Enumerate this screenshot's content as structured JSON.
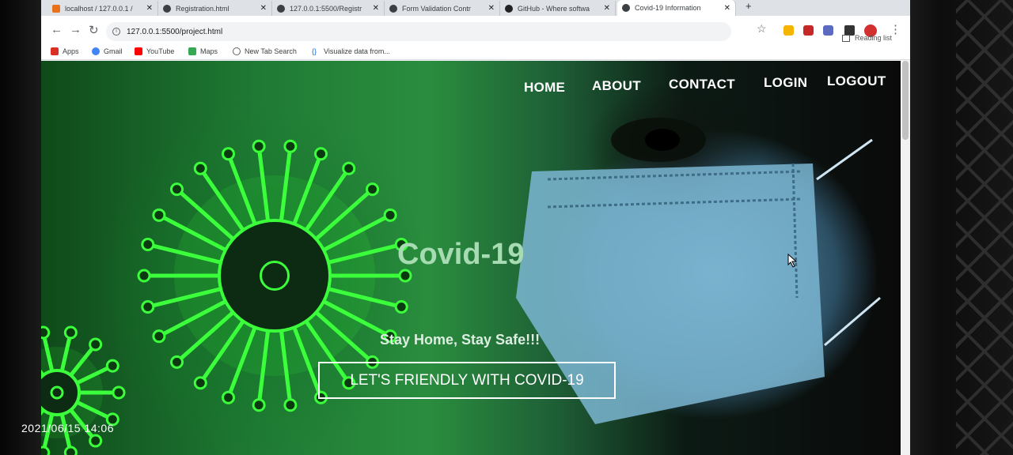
{
  "browser": {
    "tabs": [
      {
        "title": "localhost / 127.0.0.1 /",
        "icon": "phpmyadmin-icon"
      },
      {
        "title": "Registration.html",
        "icon": "globe-icon"
      },
      {
        "title": "127.0.0.1:5500/Registr",
        "icon": "globe-icon"
      },
      {
        "title": "Form Validation Contr",
        "icon": "globe-icon"
      },
      {
        "title": "GitHub - Where softwa",
        "icon": "github-icon"
      },
      {
        "title": "Covid-19 Information",
        "icon": "globe-icon",
        "active": true
      }
    ],
    "new_tab_label": "+",
    "close_glyph": "✕",
    "url": "127.0.0.1:5500/project.html",
    "reading_list": "Reading list",
    "bookmarks": [
      {
        "label": "Apps",
        "icon": "apps-grid-icon",
        "color": "#d93025"
      },
      {
        "label": "Gmail",
        "icon": "google-icon",
        "color": "#4285f4"
      },
      {
        "label": "YouTube",
        "icon": "youtube-icon",
        "color": "#ff0000"
      },
      {
        "label": "Maps",
        "icon": "maps-icon",
        "color": "#34a853"
      },
      {
        "label": "New Tab Search",
        "icon": "search-icon",
        "color": "#5f6368"
      },
      {
        "label": "Visualize data from...",
        "icon": "code-brackets-icon",
        "color": "#1a73e8"
      }
    ]
  },
  "page": {
    "nav": [
      "HOME",
      "ABOUT",
      "CONTACT",
      "LOGIN",
      "LOGOUT"
    ],
    "title": "Covid-19",
    "tagline": "Stay Home, Stay Safe!!!",
    "cta": "LET'S FRIENDLY WITH COVID-19"
  },
  "photo": {
    "timestamp": "2021/06/15 14:06"
  },
  "colors": {
    "virus_green": "#3cff3c",
    "mask_blue": "#8fc6e0",
    "nav_text": "#ffffff"
  }
}
